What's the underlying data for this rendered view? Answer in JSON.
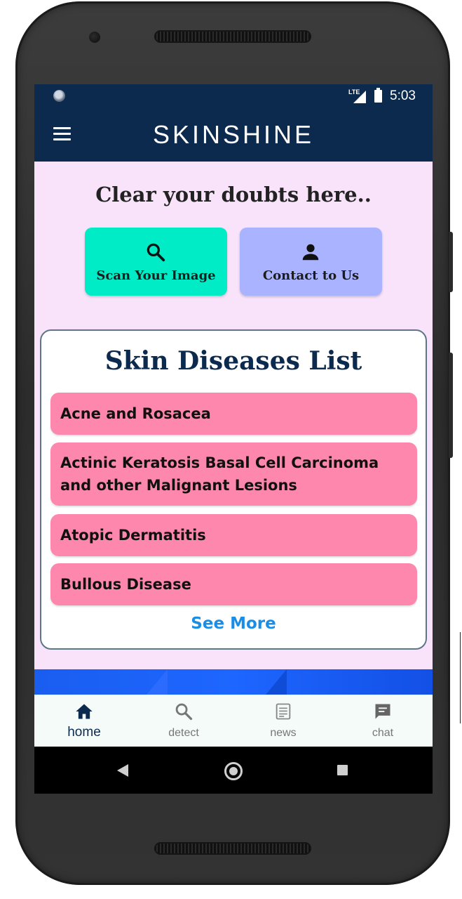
{
  "status_bar": {
    "network": "LTE",
    "time": "5:03"
  },
  "app_bar": {
    "title": "SKINSHINE",
    "menu_icon": "hamburger-menu-icon"
  },
  "main": {
    "headline": "Clear your doubts here..",
    "actions": [
      {
        "label": "Scan Your Image",
        "icon": "search-icon",
        "color": "#00ecc7"
      },
      {
        "label": "Contact to Us",
        "icon": "person-icon",
        "color": "#aab3ff"
      }
    ],
    "diseases_card": {
      "title": "Skin Diseases List",
      "items": [
        {
          "label": "Acne and Rosacea"
        },
        {
          "label": "Actinic Keratosis Basal Cell Carcinoma and other Malignant Lesions"
        },
        {
          "label": "Atopic Dermatitis"
        },
        {
          "label": "Bullous Disease"
        }
      ],
      "see_more": "See More",
      "item_color": "#fd87ad"
    }
  },
  "bottom_nav": {
    "items": [
      {
        "label": "home",
        "icon": "home-icon",
        "active": true
      },
      {
        "label": "detect",
        "icon": "search-icon",
        "active": false
      },
      {
        "label": "news",
        "icon": "news-icon",
        "active": false
      },
      {
        "label": "chat",
        "icon": "chat-icon",
        "active": false
      }
    ]
  },
  "colors": {
    "primary": "#0c2a4d",
    "background": "#f8e3fb",
    "link": "#1a8ee6"
  }
}
